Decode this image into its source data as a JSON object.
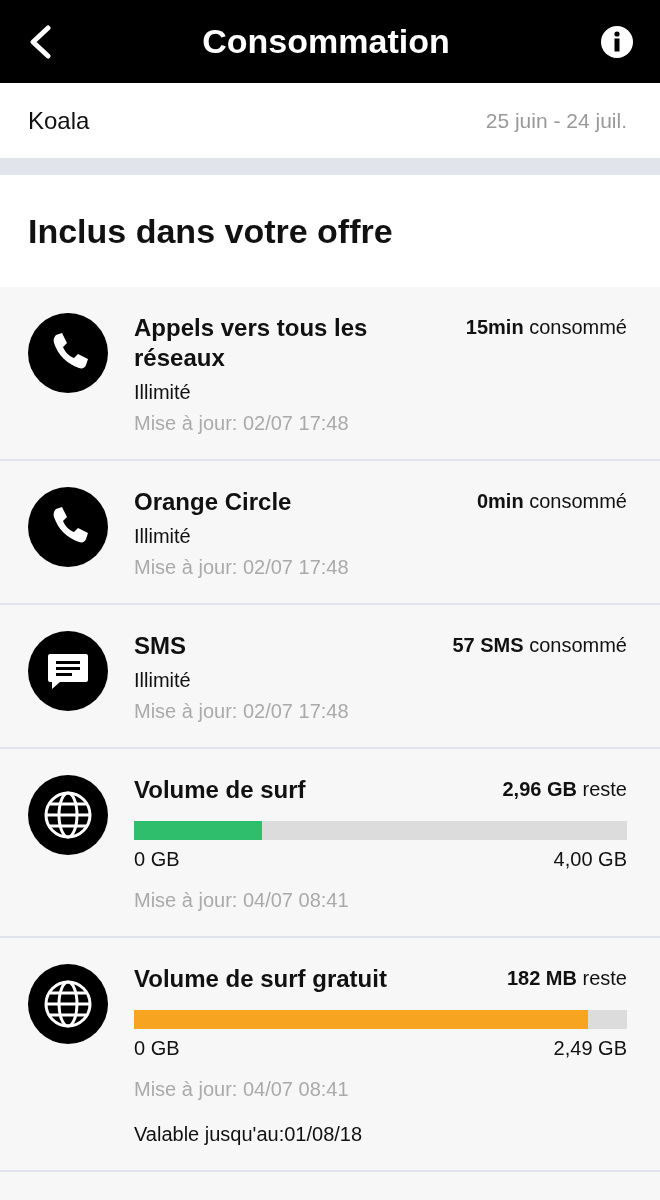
{
  "header": {
    "title": "Consommation"
  },
  "account": {
    "name": "Koala",
    "period": "25 juin - 24 juil."
  },
  "section": {
    "title": "Inclus dans votre offre"
  },
  "items": [
    {
      "kind": "call",
      "title": "Appels vers tous les réseaux",
      "amount": "15min",
      "amount_label": "consommé",
      "plan": "Illimité",
      "updated": "Mise à jour: 02/07 17:48"
    },
    {
      "kind": "call",
      "title": "Orange Circle",
      "amount": "0min",
      "amount_label": "consommé",
      "plan": "Illimité",
      "updated": "Mise à jour: 02/07 17:48"
    },
    {
      "kind": "sms",
      "title": "SMS",
      "amount": "57 SMS",
      "amount_label": "consommé",
      "plan": "Illimité",
      "updated": "Mise à jour: 02/07 17:48"
    },
    {
      "kind": "data",
      "title": "Volume de surf",
      "amount": "2,96 GB",
      "amount_label": "reste",
      "level": 0.26,
      "color": "#2fbf6c",
      "min": "0 GB",
      "max": "4,00 GB",
      "updated": "Mise à jour: 04/07 08:41"
    },
    {
      "kind": "data",
      "title": "Volume de surf gratuit",
      "amount": "182 MB",
      "amount_label": "reste",
      "level": 0.92,
      "color": "#f7a520",
      "min": "0 GB",
      "max": "2,49 GB",
      "updated": "Mise à jour: 04/07 08:41",
      "validity": "Valable jusqu'au:01/08/18"
    }
  ]
}
